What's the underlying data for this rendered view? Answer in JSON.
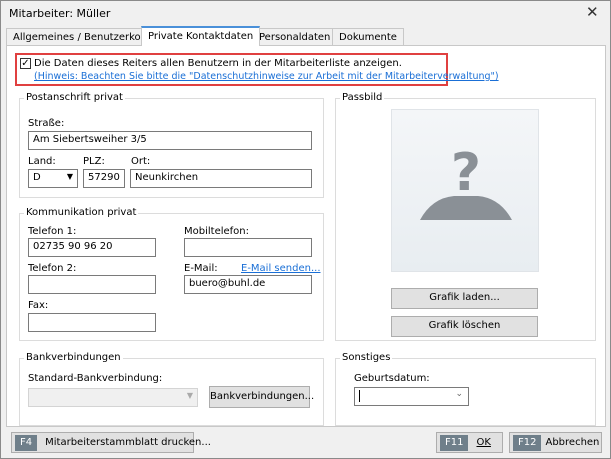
{
  "window": {
    "title": "Mitarbeiter: Müller",
    "close_icon": "close-icon"
  },
  "tabs": [
    {
      "label": "Allgemeines / Benutzerkonto"
    },
    {
      "label": "Private Kontaktdaten",
      "active": true
    },
    {
      "label": "Personaldaten"
    },
    {
      "label": "Dokumente"
    }
  ],
  "visibility": {
    "checked": true,
    "label": "Die Daten dieses Reiters allen Benutzern in der Mitarbeiterliste anzeigen.",
    "hint_link": "(Hinweis: Beachten Sie bitte die \"Datenschutzhinweise zur Arbeit mit der Mitarbeiterverwaltung\")",
    "highlight_color": "#e04040"
  },
  "address": {
    "title": "Postanschrift privat",
    "street_label": "Straße:",
    "street": "Am Siebertsweiher 3/5",
    "country_label": "Land:",
    "country": "D",
    "zip_label": "PLZ:",
    "zip": "57290",
    "city_label": "Ort:",
    "city": "Neunkirchen"
  },
  "communication": {
    "title": "Kommunikation privat",
    "phone1_label": "Telefon 1:",
    "phone1": "02735 90 96 20",
    "mobile_label": "Mobiltelefon:",
    "mobile": "",
    "phone2_label": "Telefon 2:",
    "phone2": "",
    "email_label": "E-Mail:",
    "email_link": "E-Mail senden...",
    "email": "buero@buhl.de",
    "fax_label": "Fax:",
    "fax": ""
  },
  "photo": {
    "title": "Passbild",
    "load_button": "Grafik laden...",
    "delete_button": "Grafik löschen"
  },
  "bank": {
    "title": "Bankverbindungen",
    "default_label": "Standard-Bankverbindung:",
    "default_value": "",
    "button": "Bankverbindungen..."
  },
  "other": {
    "title": "Sonstiges",
    "birthdate_label": "Geburtsdatum:",
    "birthdate": ""
  },
  "footer": {
    "print_key": "F4",
    "print_label": "Mitarbeiterstammblatt drucken...",
    "ok_key": "F11",
    "ok_label": "OK",
    "cancel_key": "F12",
    "cancel_label": "Abbrechen"
  }
}
